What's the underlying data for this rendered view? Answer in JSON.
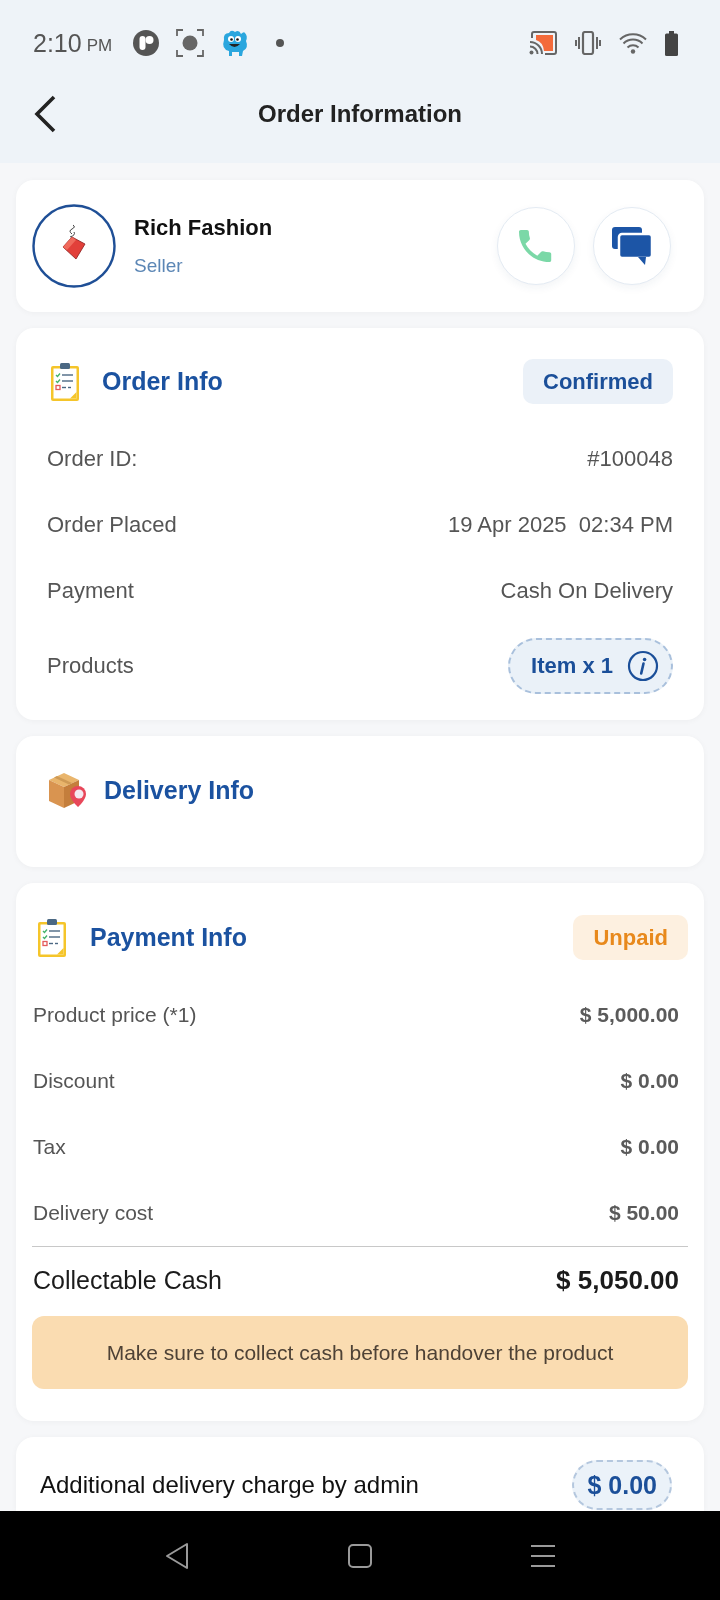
{
  "status_bar": {
    "time": "2:10",
    "period": "PM"
  },
  "header": {
    "title": "Order Information"
  },
  "seller": {
    "name": "Rich Fashion",
    "role": "Seller"
  },
  "order_info": {
    "title": "Order Info",
    "status": "Confirmed",
    "rows": [
      {
        "kind": "text",
        "label": "Order ID:",
        "value": "#100048"
      },
      {
        "kind": "text",
        "label": "Order Placed",
        "value": "19 Apr 2025  02:34 PM"
      },
      {
        "kind": "text",
        "label": "Payment",
        "value": "Cash On Delivery"
      },
      {
        "kind": "chip",
        "label": "Products",
        "value": "Item x 1"
      }
    ]
  },
  "delivery_info": {
    "title": "Delivery Info"
  },
  "payment_info": {
    "title": "Payment Info",
    "status": "Unpaid",
    "rows": [
      {
        "label": "Product price (*1)",
        "value": "$ 5,000.00"
      },
      {
        "label": "Discount",
        "value": "$ 0.00"
      },
      {
        "label": "Tax",
        "value": "$ 0.00"
      },
      {
        "label": "Delivery cost",
        "value": "$ 50.00"
      }
    ],
    "total": {
      "label": "Collectable Cash",
      "value": "$ 5,050.00"
    },
    "notice": "Make sure to collect cash before handover the product"
  },
  "additional_charge": {
    "label": "Additional delivery charge by admin",
    "value": "$ 0.00"
  }
}
